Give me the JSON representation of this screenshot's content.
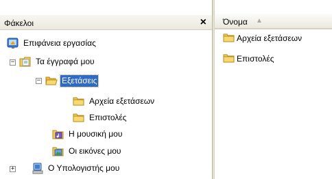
{
  "folders_pane": {
    "title": "Φάκελοι",
    "close_glyph": "×"
  },
  "tree": [
    {
      "label": "Επιφάνεια εργασίας",
      "icon": "desktop-icon",
      "expander": ""
    },
    {
      "label": "Τα έγγραφά μου",
      "icon": "my-documents-icon",
      "expander": "−"
    },
    {
      "label": "Εξετάσεις",
      "icon": "open-folder-icon",
      "expander": "−",
      "selected": true
    },
    {
      "label": "Αρχεία εξετάσεων",
      "icon": "folder-icon",
      "expander": ""
    },
    {
      "label": "Επιστολές",
      "icon": "folder-icon",
      "expander": ""
    },
    {
      "label": "Η μουσική μου",
      "icon": "my-music-icon",
      "expander": ""
    },
    {
      "label": "Οι εικόνες μου",
      "icon": "my-pictures-icon",
      "expander": ""
    },
    {
      "label": "Ο Υπολογιστής μου",
      "icon": "my-computer-icon",
      "expander": "+"
    }
  ],
  "list_pane": {
    "column_name": "Όνομα",
    "sort_indicator": "▲",
    "items": [
      {
        "label": "Αρχεία εξετάσεων",
        "icon": "folder-icon"
      },
      {
        "label": "Επιστολές",
        "icon": "folder-icon"
      }
    ]
  },
  "colors": {
    "selection": "#316ac5",
    "folder_yellow": "#f5cf5b"
  }
}
